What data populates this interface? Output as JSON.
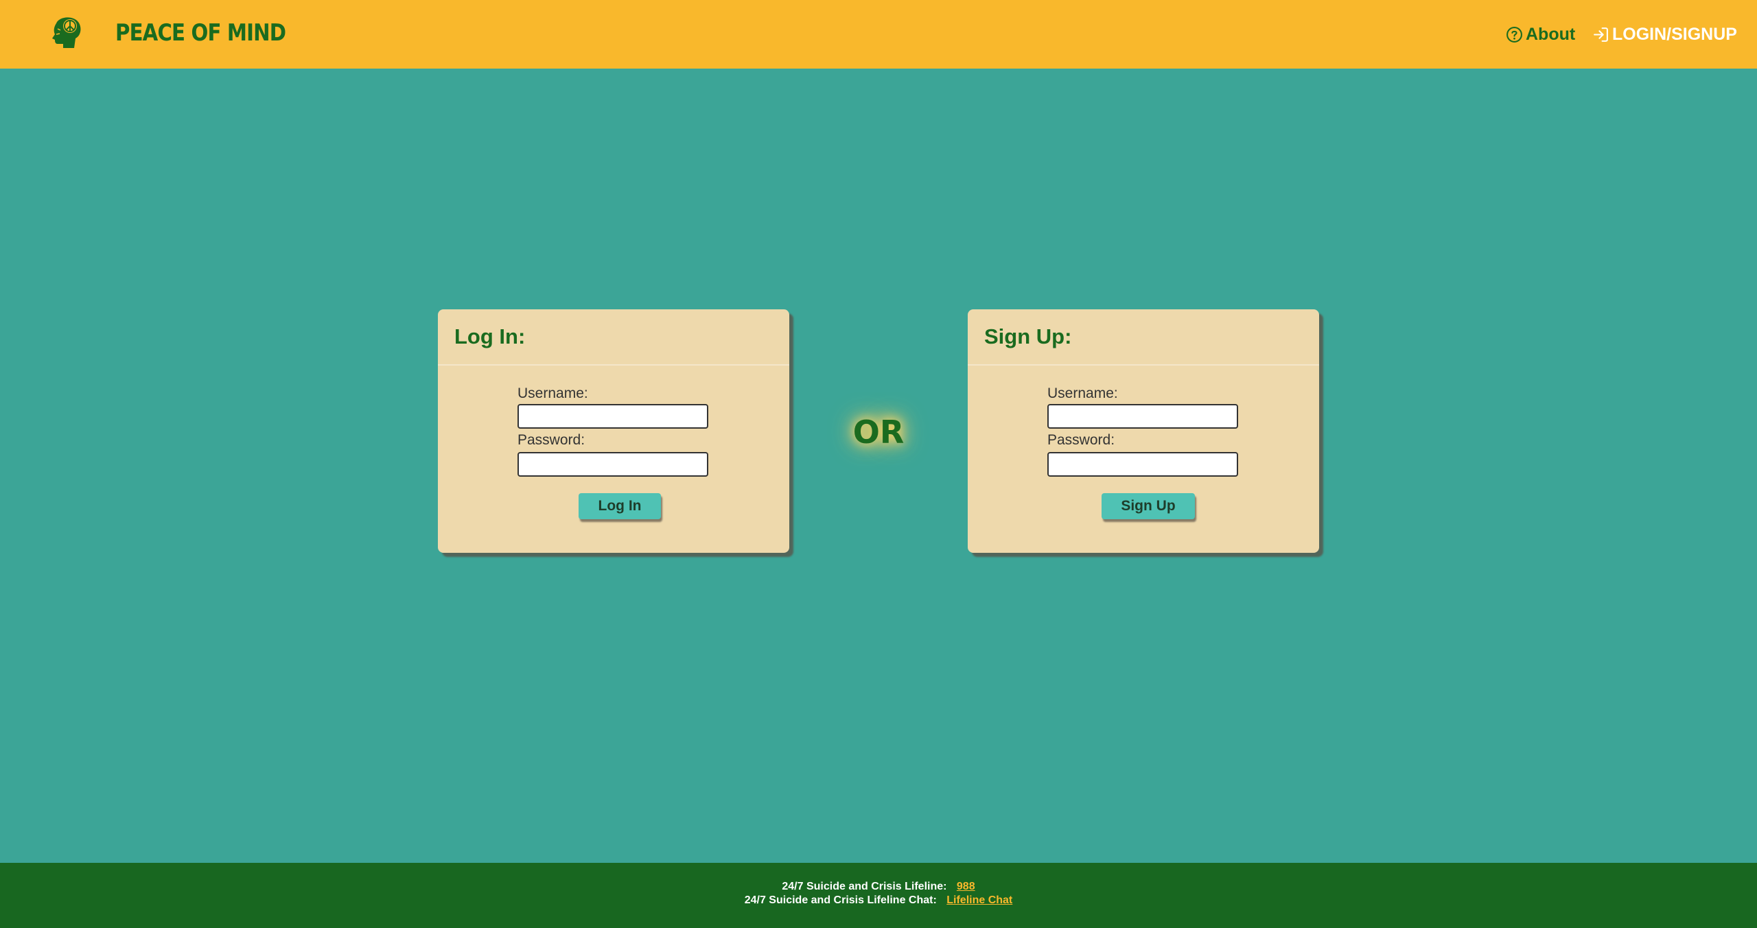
{
  "header": {
    "brand": "PEACE OF MIND",
    "nav": {
      "about": "About",
      "login_signup": "LOGIN/SIGNUP"
    }
  },
  "login_card": {
    "title": "Log In:",
    "username_label": "Username:",
    "username_value": "",
    "password_label": "Password:",
    "password_value": "",
    "button": "Log In"
  },
  "divider": {
    "text": "OR"
  },
  "signup_card": {
    "title": "Sign Up:",
    "username_label": "Username:",
    "username_value": "",
    "password_label": "Password:",
    "password_value": "",
    "button": "Sign Up"
  },
  "footer": {
    "lifeline_label": "24/7 Suicide and Crisis Lifeline:",
    "lifeline_number": "988",
    "chat_label": "24/7 Suicide and Crisis Lifeline Chat:",
    "chat_link": "Lifeline Chat"
  },
  "icons": {
    "logo": "head-with-peace-sign-icon",
    "about": "question-circle-icon",
    "login": "login-arrow-icon"
  },
  "colors": {
    "header_bg": "#f9b82c",
    "page_bg": "#3ca597",
    "brand_green": "#1a6b1f",
    "card_bg": "#eed9ac",
    "button_bg": "#4fc2b4",
    "footer_bg": "#186720",
    "footer_link": "#f9b82c"
  }
}
